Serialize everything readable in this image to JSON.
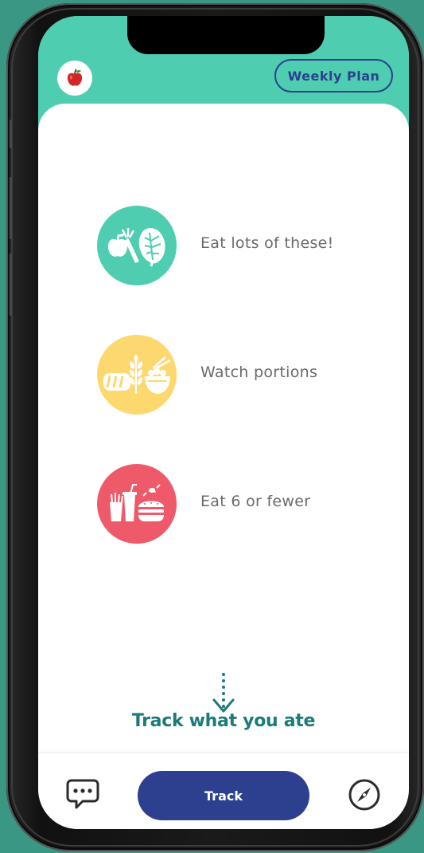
{
  "header": {
    "weekly_plan_label": "Weekly Plan",
    "logo_icon": "apple-icon"
  },
  "food_groups": [
    {
      "label": "Eat lots of these!",
      "icon": "fruits-vegetables-icon",
      "color": "#4ecdb1"
    },
    {
      "label": "Watch portions",
      "icon": "grains-icon",
      "color": "#fcd86e"
    },
    {
      "label": "Eat 6 or fewer",
      "icon": "junk-food-icon",
      "color": "#ef5a6a"
    }
  ],
  "prompt": {
    "text": "Track what you ate"
  },
  "bottom_bar": {
    "track_label": "Track",
    "chat_icon": "chat-icon",
    "compass_icon": "compass-icon"
  },
  "colors": {
    "teal": "#4ecdb1",
    "navy": "#2d3f8f",
    "dark_teal": "#1c7a78",
    "background": "#3a9783"
  }
}
